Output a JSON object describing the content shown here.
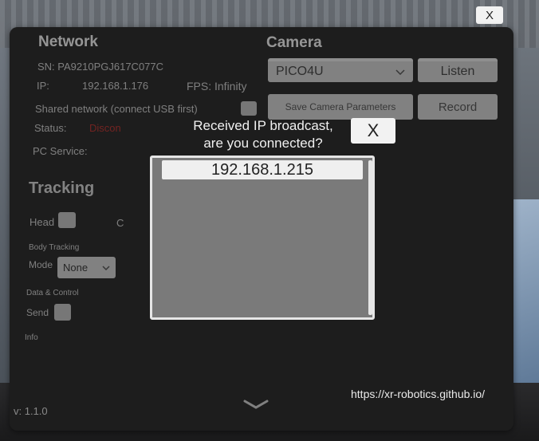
{
  "top": {
    "close_label": "X"
  },
  "network": {
    "heading": "Network",
    "sn": "SN: PA9210PGJ617C077C",
    "ip_label": "IP:",
    "ip_value": "192.168.1.176",
    "fps": "FPS: Infinity",
    "shared_network": "Shared network (connect USB first)",
    "status_label": "Status:",
    "status_value": "Discon",
    "pc_service_label": "PC Service:"
  },
  "tracking": {
    "heading": "Tracking",
    "head_label": "Head",
    "c_label": "C",
    "body_tracking_label": "Body Tracking",
    "mode_label": "Mode",
    "mode_value": "None",
    "data_control_label": "Data & Control",
    "send_label": "Send",
    "info_label": "Info"
  },
  "camera": {
    "heading": "Camera",
    "device_value": "PICO4U",
    "listen_label": "Listen",
    "save_params_label": "Save Camera Parameters",
    "record_label": "Record"
  },
  "dialog": {
    "title": "Received IP broadcast,\nare you connected?",
    "close_label": "X",
    "items": [
      "192.168.1.215"
    ]
  },
  "footer": {
    "version": "v: 1.1.0",
    "url": "https://xr-robotics.github.io/"
  },
  "icons": {
    "dropdown": "chevron-down-icon",
    "expand": "chevron-down-icon"
  },
  "colors": {
    "panel": "#262626",
    "status_error": "#c0312d",
    "button": "#dadada"
  }
}
